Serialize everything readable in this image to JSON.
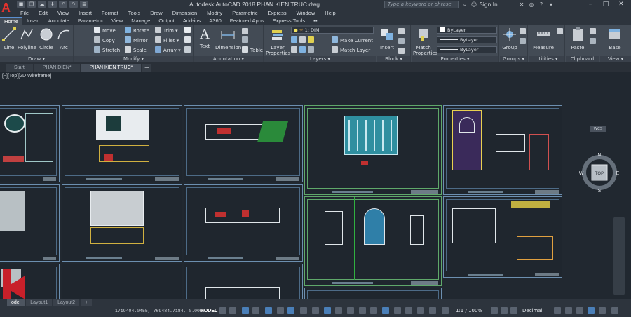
{
  "app": {
    "logo": "A",
    "title": "Autodesk AutoCAD 2018   PHAN KIEN TRUC.dwg",
    "search_placeholder": "Type a keyword or phrase",
    "sign_in": "Sign In",
    "window_buttons": [
      "–",
      "□",
      "✕"
    ]
  },
  "quick_access": [
    "■",
    "❐",
    "☁",
    "⬇",
    "↶",
    "↷",
    "≣"
  ],
  "menubar": [
    "File",
    "Edit",
    "View",
    "Insert",
    "Format",
    "Tools",
    "Draw",
    "Dimension",
    "Modify",
    "Parametric",
    "Express",
    "Window",
    "Help"
  ],
  "ribbon_tabs": [
    "Home",
    "Insert",
    "Annotate",
    "Parametric",
    "View",
    "Manage",
    "Output",
    "Add-ins",
    "A360",
    "Featured Apps",
    "Express Tools",
    "▪▪"
  ],
  "ribbon": {
    "draw": {
      "label": "Draw ▾",
      "buttons": [
        "Line",
        "Polyline",
        "Circle",
        "Arc"
      ]
    },
    "modify": {
      "label": "Modify ▾",
      "buttons": [
        "Move",
        "Rotate",
        "Trim ▾",
        "Copy",
        "Mirror",
        "Fillet ▾",
        "Stretch",
        "Scale",
        "Array ▾"
      ]
    },
    "annotation": {
      "label": "Annotation ▾",
      "buttons": [
        "Text",
        "Dimension",
        "Table"
      ]
    },
    "layers": {
      "label": "Layers ▾",
      "layer_properties": "Layer Properties",
      "current_layer": "1: DIM",
      "make_current": "Make Current",
      "match_layer": "Match Layer"
    },
    "block": {
      "label": "Block ▾",
      "insert": "Insert"
    },
    "properties": {
      "label": "Properties ▾",
      "match": "Match Properties",
      "bylayer": [
        "ByLayer",
        "ByLayer",
        "ByLayer"
      ]
    },
    "groups": {
      "label": "Groups ▾",
      "group": "Group"
    },
    "utilities": {
      "label": "Utilities ▾",
      "measure": "Measure"
    },
    "clipboard": {
      "label": "Clipboard",
      "paste": "Paste"
    },
    "view": {
      "label": "View ▾",
      "base": "Base"
    }
  },
  "doc_tabs": [
    "Start",
    "PHAN DIEN*",
    "PHAN KIEN TRUC*"
  ],
  "viewport": {
    "label": "[−][Top][2D Wireframe]"
  },
  "navcube": {
    "top": "TOP",
    "n": "N",
    "s": "S",
    "e": "E",
    "w": "W",
    "wcs": "WCS"
  },
  "status": {
    "layout_tabs": [
      "odel",
      "Layout1",
      "Layout2",
      "+"
    ],
    "coords": "1719404.0455, 769484.7184, 0.0000",
    "model": "MODEL",
    "scale": "1:1 / 100%",
    "units": "Decimal"
  },
  "colors": {
    "accent": "#5a8fd0",
    "autocad_red": "#e0322d",
    "cad_bg": "#212830",
    "sheet_border": "#6c8fb0"
  }
}
